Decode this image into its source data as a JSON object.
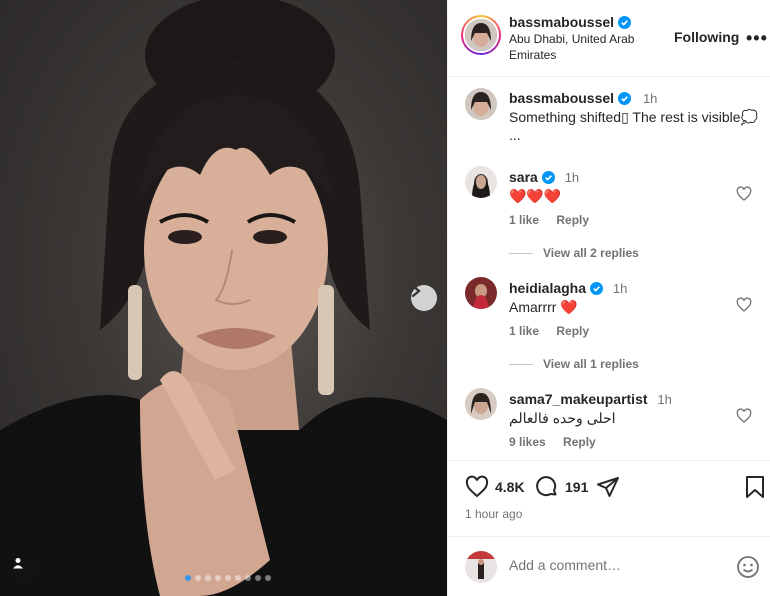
{
  "post": {
    "author": "bassmaboussel",
    "location": "Abu Dhabi, United Arab Emirates",
    "follow_label": "Following",
    "more_label": "•••",
    "carousel_total": 9,
    "carousel_active": 1
  },
  "caption": {
    "user": "bassmaboussel",
    "time": "1h",
    "text": "Something shifted▯ The rest is visible💭 ..."
  },
  "comments": [
    {
      "user": "sara",
      "time": "1h",
      "text": "❤️❤️❤️",
      "likes": "1 like",
      "reply_label": "Reply",
      "replies_label": "View all 2 replies"
    },
    {
      "user": "heidialagha",
      "time": "1h",
      "text": "Amarrrr ❤️",
      "likes": "1 like",
      "reply_label": "Reply",
      "replies_label": "View all 1 replies"
    },
    {
      "user": "sama7_makeupartist",
      "time": "1h",
      "text": "احلى وحده فالعالم",
      "likes": "9 likes",
      "reply_label": "Reply"
    }
  ],
  "stats": {
    "likes": "4.8K",
    "comments": "191",
    "time_ago": "1 hour ago"
  },
  "composer": {
    "placeholder": "Add a comment…"
  },
  "colors": {
    "verified": "#0095f6",
    "heart_red": "#e0245e",
    "text": "#262626",
    "muted": "#737373"
  }
}
